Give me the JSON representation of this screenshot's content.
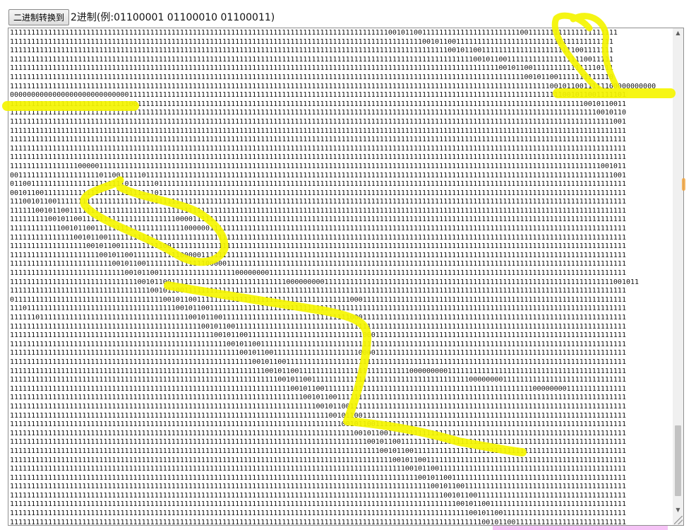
{
  "toolbar": {
    "convert_button_label": "二进制转换到",
    "format_hint": "2进制(例:01100001 01100010 01100011)"
  },
  "binary_text": "11111111111111111111111111111111111111111111111111111111111111111111111111111111111111111001011001111111111111111111111100111111111111111111111\n1111111111111111111111111111111111111111111111111111111111111111111111111111111111111111111111111001011001111111111111111111111111111111111111\n1111111111111111111111111111111111111111111111111111111111111111111111111111111111111111111111111111111001011001111111111111111111111001111111\n1111111111111111111111111111111111111111111111111111111111111111111111111111111111111111111111111111111111111001011001111111111111111110011111\n1111111111111111111111111111111111111111111111111111111111111111111111111111111111111111111111111111111111111111111001011001111111111111110111\n1111111111111111111111111111111111111111111111111111111111111111111111111111111111111111111111111111111111111111111111111001011001111111111110\n11111111111111111111111111111111111111111111111111111111111111111111111111111111111111111111111111111111111111111111111111111110010110011111100000000000\n0000000000000000000000000000111111111111111111111111111111111111111111111111111111111111111111111111111111111111111111111111111111001011001111101\n1111111111111111111111111111001111111111111111111111111111111111111111111111111111111111111111111111111111111111111111111111111111111110010110011\n1111111111111111111111111111111111111111111111111111111111111111111111111111111111111111111111111111111111111111111111111111111111111111110010110\n1111111111111111111111111111111111111111111111111111111111111111111111111111111111111111111111111111111111111111111111111111111111111111111111001\n1111111111111111111111111111111111111111111111111111111111111111111111111111111111111111111111111111111111111111111111111111111111111111111111111\n1111111111111111111111111111111111111111111111111111111111111111111111111111111111111111111111111111111111111111111111111111111111111111111111111\n1111111111111111111111111111111111111111111111111111111111111111111111111111111111111111111111111111111111111111111111111111111111111111111111111\n1111111111111111111111111111111111111111111111111111111111111111111111111111111111111111111111111111111111111111111111111111111111111111111111111\n1111111111111111000001111111111111111111111111111111111111111111111111111111111111111111111111111111111111111111111111111111111111111111111001011\n0011111111111111111110110011111011111111111111111111111111111111111111111111111111111111111111111111111111111111111111111111111111111111111111001\n0110011111111111111111111110111111011111111111111111111111111111111111111111111111111111111111111111111111111111111111111111111111111111111111111\n0010110011111111111111111111111111011111111111111111111111111111111111111111111111111111111111111111111111111111111111111111111111111111111111111\n1110010110011111111111111111111111111111111111111111111111111111111111111111111111111111111111111111111111111111111111111111111111111111111111111\n1111110010110011111111111111111111111111111111111111111111111111111111111111111111111111111111111111111111111111111111111111111111111111111111111\n1111111110010110011111111111111111111110000111111111111111111111111111111111111111111111111111111111111111111111111111111111111111111111111111111\n1111111111110010110011111111111111111111100000011111111111111111111111111111111111111111111111111111111111111111111111111111111111111111111111111\n1111111111111110010110011111111111111111111111111111111111111111111111111111111111111111111111111111111111111111111111111111111111111111111111111\n1111111111111111110010110011111111110011111111111111111111111111111111111111111111111111111111111111111111111111111111111111111111111111111111111\n1111111111111111111110010110011111111111000001111111111111111111111111111111111111111111111111111111111111111111111111111111111111111111111111111\n1111111111111111111111110010110011111111111111000001111111111111111111111111111111111111111111111111111111111111111111111111111111111111111111111\n1111111111111111111111111110010110011111111111111111100000000111111111111111111111111111111111111111111111111111111111111111111111111111111111111\n1111111111111111111111111111110010110011111111111111111111111111100000000011111111111111111111111111111111111111111111111111111111111111111111001011\n1111111111111111111111111111111110010110011111111111111111111111111111111111111111111111111111111111111111111111111111111111111111111111111111111\n0111111111111111111111111111111111110010110011111111111111111111111111111111111100011111111111111111111111111111111111111111111111111111111111111\n1110111111111111111111111111111111111110010110011111111111111111111111111111111111111111111111111111111111111111111111111111111111111111111111111\n1111110111111111111111111111111111111111110010110011111111111111111111111111111100011111111111111111111111111111111111111111111111111111111111111\n1111111111111111111111111111111111111111111110010110011111111111111111111111111111111111111111111111111111111111111111111111111111111111111111111\n1111111111111111111111111111111111111111111111110010110011111111111111111111111111100011111111111111111111111111111111111111111111111111111111111\n1111111111111111111111111111111111111111111111111110010110011111111111111111111111111111111111111111111111111111111111111111111111111111111111111\n1111111111111111111111111111111111111111111111111111110010110011111111111111111111000011111111111111111111111111111111111111111111111111111111111\n1111111111111111111111111111111111111111111111111111111110010110011111111111111111111111111111111111111111111111111111111111111111111111111111111\n1111111111111111111111111111111111111111111111111111111111110010110011111111111111111111111111000000000111111111111111111111111111111111111111111\n1111111111111111111111111111111111111111111111111111111111111110010110011111111111111111111111111111111111110000000011111111111111111111111111111\n1111111111111111111111111111111111111111111111111111111111111111110010110011111111111111111111111111111111111111111111111110000000011111111111111\n1111111111111111111111111111111111111111111111111111111111111111111110010110011111111111111111111111111111111111111111111111111111111111111111111\n1111111111111111111111111111111111111111111111111111111111111111111111110010110011111111111111111111111111111111111111111111111111111111111111111\n1111111111111111111111111111111111111111111111111111111111111111111111111110010110011111111111111111111111111111111111111111111111111111111111111\n1111111111111111111111111111111111111111111111111111111111111111111111111111110010110011111111111111111111111111111111111111111111111111111111111\n1111111111111111111111111111111111111111111111111111111111111111111111111111111110010110011111111111111111111111111111111111111111111111111111111\n1111111111111111111111111111111111111111111111111111111111111111111111111111111111110010110011111111111111111111111111111111111111111111111111111\n1111111111111111111111111111111111111111111111111111111111111111111111111111111111111110010110011111111111111111111111111111111111111111111111111\n1111111111111111111111111111111111111111111111111111111111111111111111111111111111111111110010110011111111111111111111111111111111111111111111111\n1111111111111111111111111111111111111111111111111111111111111111111111111111111111111111111110010110011111111111111111111111111111111111111111111\n1111111111111111111111111111111111111111111111111111111111111111111111111111111111111111111111110010110011111111111111111111111111111111111111111\n1111111111111111111111111111111111111111111111111111111111111111111111111111111111111111111111111110010110011111111111111111111111111111111111111\n1111111111111111111111111111111111111111111111111111111111111111111111111111111111111111111111111111110010110011111111111111111111111111111111111\n1111111111111111111111111111111111111111111111111111111111111111111111111111111111111111111111111111111110010110011111111111111111111111111111111\n1111111111111111111111111111111111111111111111111111111111111111111111111111111111111111111111111111111111110010110011111111111111111111111111111\n1111111111111111111111111111111111111111111111111111111111111111111111111111111111111111111111111111111111111110010110011111111111111111111111111",
  "colors": {
    "highlighter": "#f5f500",
    "pink_strip": "#f6c3f6",
    "orange_dot": "#f2a23a"
  }
}
